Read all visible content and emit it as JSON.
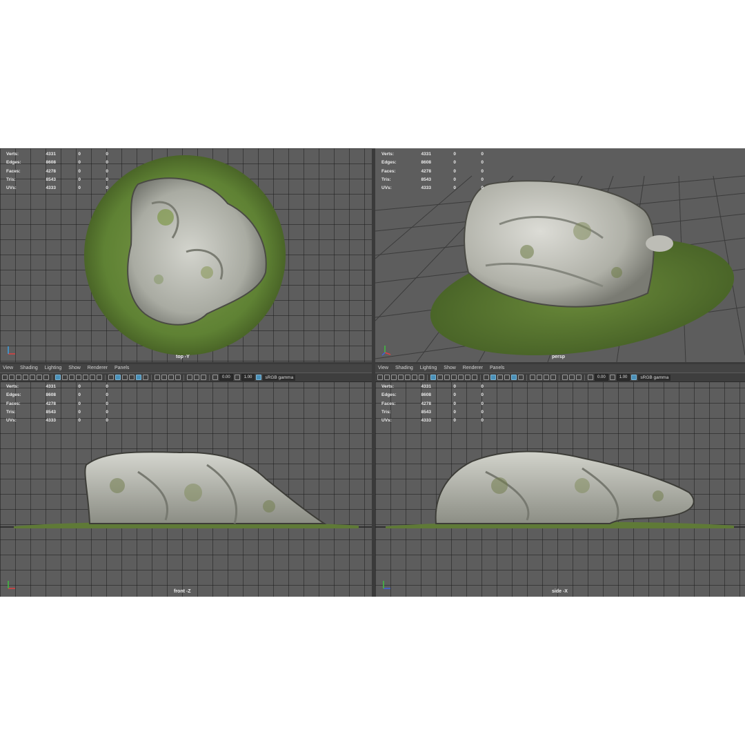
{
  "stats": {
    "rows": [
      {
        "label": "Verts:",
        "v1": "4331",
        "v2": "0",
        "v3": "0"
      },
      {
        "label": "Edges:",
        "v1": "8608",
        "v2": "0",
        "v3": "0"
      },
      {
        "label": "Faces:",
        "v1": "4278",
        "v2": "0",
        "v3": "0"
      },
      {
        "label": "Tris:",
        "v1": "8543",
        "v2": "0",
        "v3": "0"
      },
      {
        "label": "UVs:",
        "v1": "4333",
        "v2": "0",
        "v3": "0"
      }
    ]
  },
  "menu": {
    "view": "View",
    "shading": "Shading",
    "lighting": "Lighting",
    "show": "Show",
    "renderer": "Renderer",
    "panels": "Panels"
  },
  "toolbar": {
    "exposure": "0.00",
    "gamma": "1.00",
    "colorspace": "sRGB gamma"
  },
  "viewports": {
    "top": {
      "camera": "top -Y"
    },
    "persp": {
      "camera": "persp"
    },
    "front": {
      "camera": "front -Z"
    },
    "side": {
      "camera": "side -X"
    }
  },
  "colors": {
    "viewport_bg": "#5d5d5d",
    "grid": "#2e2e2e",
    "rock": "#b9bab3",
    "moss": "#6b8a3a",
    "accent": "#4a90b8"
  },
  "icons": [
    "camera-icon",
    "grid-icon",
    "wireframe-icon",
    "smooth-shade-icon",
    "texture-icon",
    "light-icon",
    "isolate-icon",
    "xray-icon",
    "exposure-icon",
    "gamma-icon",
    "color-space-icon"
  ]
}
